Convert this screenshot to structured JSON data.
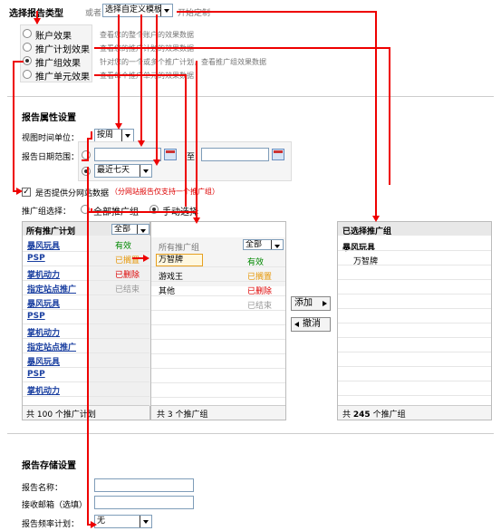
{
  "type_section": {
    "title": "选择报告类型",
    "or_text": "或者",
    "template_select": "选择自定义模板",
    "start_text": "开始定制",
    "options": [
      {
        "label": "账户效果",
        "desc": "查看您的整个账户的效果数据"
      },
      {
        "label": "推广计划效果",
        "desc": "查看您的推广计划的效果数据"
      },
      {
        "label": "推广组效果",
        "desc": "针对您的一个或多个推广计划，查看推广组效果数据"
      },
      {
        "label": "推广单元效果",
        "desc": "查看每个推广单元的效果数据"
      }
    ]
  },
  "attr_section": {
    "title": "报告属性设置",
    "view_unit_label": "视图时间单位：",
    "view_unit_value": "按周",
    "date_range_label": "报告日期范围：",
    "to_text": "至",
    "preset_value": "最近七天",
    "subsite_label": "是否提供分网站数据",
    "subsite_note": "（分网站报告仅支持一个推广组）",
    "group_select_label": "推广组选择：",
    "all_groups": "全部推广组",
    "manual_select": "手动选择"
  },
  "left_panel": {
    "header": "所有推广计划",
    "filter": "全部",
    "footer": "共 100 个推广计划",
    "items": [
      {
        "name": "暴风玩具",
        "status": "有效"
      },
      {
        "name": "PSP",
        "status": "已搁置"
      },
      {
        "name": "掌机动力",
        "status": "已删除"
      },
      {
        "name": "指定站点推广",
        "status": "已结束"
      },
      {
        "name": "暴风玩具",
        "status": ""
      },
      {
        "name": "PSP",
        "status": ""
      },
      {
        "name": "掌机动力",
        "status": ""
      },
      {
        "name": "指定站点推广",
        "status": ""
      },
      {
        "name": "暴风玩具",
        "status": ""
      },
      {
        "name": "PSP",
        "status": ""
      },
      {
        "name": "掌机动力",
        "status": ""
      }
    ]
  },
  "mid_panel": {
    "header": "所有推广组",
    "filter": "全部",
    "footer": "共 3 个推广组",
    "items": [
      {
        "name": "万智牌",
        "status": "有效"
      },
      {
        "name": "游戏王",
        "status": "已搁置"
      },
      {
        "name": "其他",
        "status": "已删除"
      },
      {
        "name": "",
        "status": "已结束"
      }
    ]
  },
  "buttons": {
    "add": "添加",
    "remove": "撤消"
  },
  "right_panel": {
    "header": "已选择推广组",
    "group": "暴风玩具",
    "item": "万智牌",
    "footer_pre": "共",
    "footer_count": "245",
    "footer_post": "个推广组"
  },
  "save_section": {
    "title": "报告存储设置",
    "name_label": "报告名称：",
    "email_label": "接收邮箱（选填）",
    "freq_label": "报告频率计划：",
    "freq_value": "无"
  },
  "colors": {
    "annotation": "#e00000",
    "link": "#1a3fa0",
    "status_green": "#008800",
    "status_orange": "#e69500",
    "status_red": "#dd0000"
  }
}
